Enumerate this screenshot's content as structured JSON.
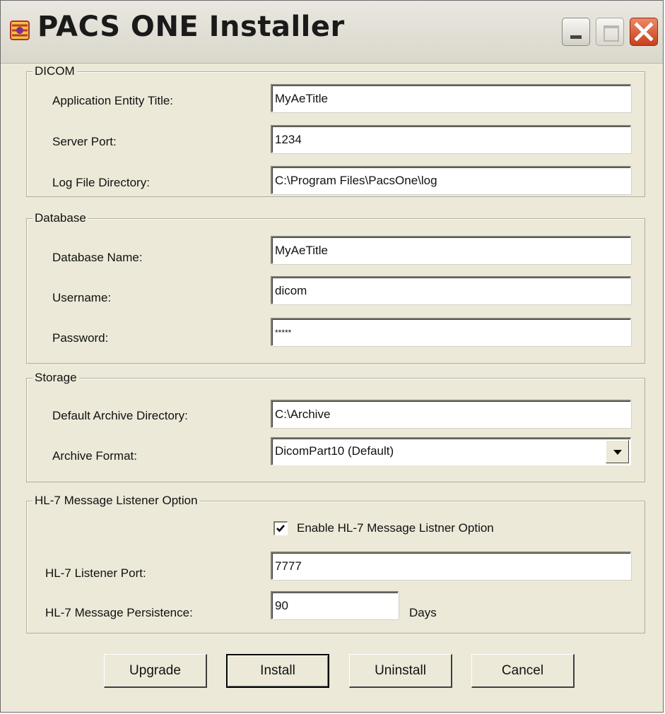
{
  "window": {
    "title": "PACS ONE Installer",
    "icon": "pacs-one-app-icon",
    "controls": [
      "minimize-icon",
      "maximize-icon",
      "close-icon"
    ]
  },
  "dicom": {
    "legend": "DICOM",
    "ae_title_label": "Application Entity Title:",
    "ae_title_value": "MyAeTitle",
    "port_label": "Server Port:",
    "port_value": "1234",
    "log_dir_label": "Log File Directory:",
    "log_dir_value": "C:\\Program Files\\PacsOne\\log"
  },
  "database": {
    "legend": "Database",
    "name_label": "Database Name:",
    "name_value": "MyAeTitle",
    "username_label": "Username:",
    "username_value": "dicom",
    "password_label": "Password:",
    "password_value": "*****"
  },
  "storage": {
    "legend": "Storage",
    "archive_dir_label": "Default Archive Directory:",
    "archive_dir_value": "C:\\Archive",
    "format_label": "Archive Format:",
    "format_value": "DicomPart10 (Default)"
  },
  "hl7": {
    "legend": "HL-7 Message Listener Option",
    "enable_label": "Enable HL-7 Message Listner Option",
    "enabled": true,
    "port_label": "HL-7 Listener Port:",
    "port_value": "7777",
    "persistence_label": "HL-7 Message Persistence:",
    "persistence_value": "90",
    "days_label": "Days"
  },
  "buttons": {
    "upgrade": "Upgrade",
    "install": "Install",
    "uninstall": "Uninstall",
    "cancel": "Cancel"
  },
  "colors": {
    "dialog_bg": "#ece9d8",
    "close_button": "#d9542b"
  }
}
